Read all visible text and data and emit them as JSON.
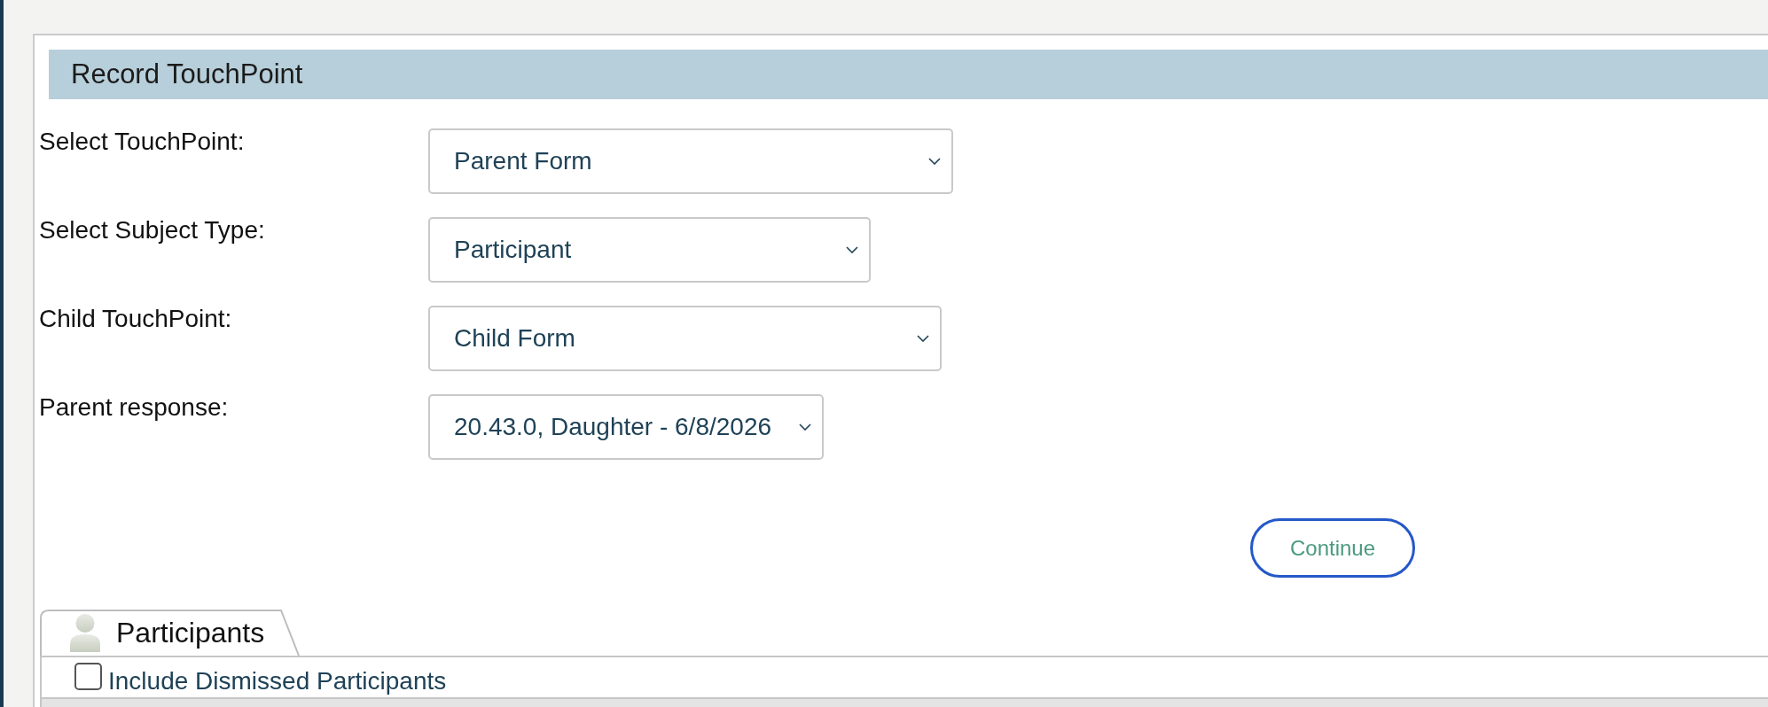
{
  "header": {
    "title": "Record TouchPoint"
  },
  "fields": [
    {
      "label": "Select TouchPoint:",
      "value": "Parent Form"
    },
    {
      "label": "Select Subject Type:",
      "value": "Participant"
    },
    {
      "label": "Child TouchPoint:",
      "value": "Child Form"
    },
    {
      "label": "Parent response:",
      "value": "20.43.0, Daughter - 6/8/2026"
    }
  ],
  "continue_button": {
    "label": "Continue"
  },
  "tabs": [
    {
      "label": "Participants",
      "selected": true
    }
  ],
  "include_dismissed": {
    "label": "Include Dismissed Participants",
    "checked": false
  }
}
